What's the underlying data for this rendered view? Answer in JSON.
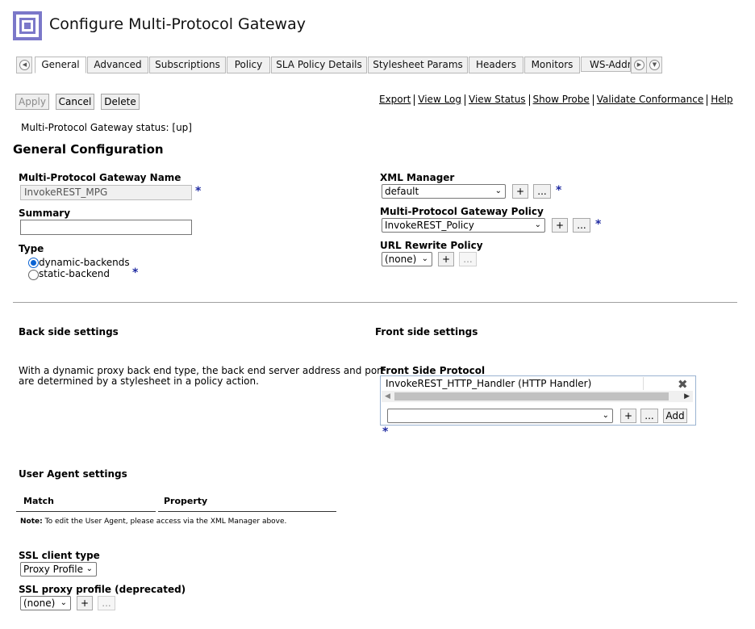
{
  "header": {
    "title": "Configure Multi-Protocol Gateway",
    "logo_icon": "datapower-logo-icon"
  },
  "tabs": [
    {
      "label": "General",
      "active": true
    },
    {
      "label": "Advanced"
    },
    {
      "label": "Subscriptions"
    },
    {
      "label": "Policy"
    },
    {
      "label": "SLA Policy Details"
    },
    {
      "label": "Stylesheet Params"
    },
    {
      "label": "Headers"
    },
    {
      "label": "Monitors"
    },
    {
      "label": "WS-Addr"
    }
  ],
  "toolbar": {
    "apply": "Apply",
    "cancel": "Cancel",
    "delete": "Delete"
  },
  "links": [
    "Export",
    "View Log",
    "View Status",
    "Show Probe",
    "Validate Conformance",
    "Help"
  ],
  "status_text": "Multi-Protocol Gateway status: [up]",
  "general": {
    "heading": "General Configuration",
    "name_label": "Multi-Protocol Gateway Name",
    "name_value": "InvokeREST_MPG",
    "summary_label": "Summary",
    "summary_value": "",
    "type_label": "Type",
    "type_options": [
      "dynamic-backends",
      "static-backend"
    ],
    "type_selected": "dynamic-backends",
    "xml_manager_label": "XML Manager",
    "xml_manager_value": "default",
    "policy_label": "Multi-Protocol Gateway Policy",
    "policy_value": "InvokeREST_Policy",
    "url_rewrite_label": "URL Rewrite Policy",
    "url_rewrite_value": "(none)",
    "required_mark": "*",
    "plus": "+",
    "ellipsis": "..."
  },
  "backside": {
    "heading": "Back side settings",
    "description_line1": "With a dynamic proxy back end type, the back end server address and port",
    "description_line2": "are determined by a stylesheet in a policy action."
  },
  "frontside": {
    "heading": "Front side settings",
    "protocol_label": "Front Side Protocol",
    "handler_entry": "InvokeREST_HTTP_Handler (HTTP Handler)",
    "add_button": "Add",
    "select_value": ""
  },
  "user_agent": {
    "heading": "User Agent settings",
    "col_match": "Match",
    "col_property": "Property",
    "note_label": "Note:",
    "note_text": "To edit the User Agent, please access via the XML Manager above."
  },
  "ssl": {
    "client_type_label": "SSL client type",
    "client_type_value": "Proxy Profile",
    "proxy_profile_label": "SSL proxy profile (deprecated)",
    "proxy_profile_value": "(none)"
  },
  "colors": {
    "accent": "#1f2aa1",
    "logo": "#7b78c9",
    "radio": "#0b63d3"
  }
}
